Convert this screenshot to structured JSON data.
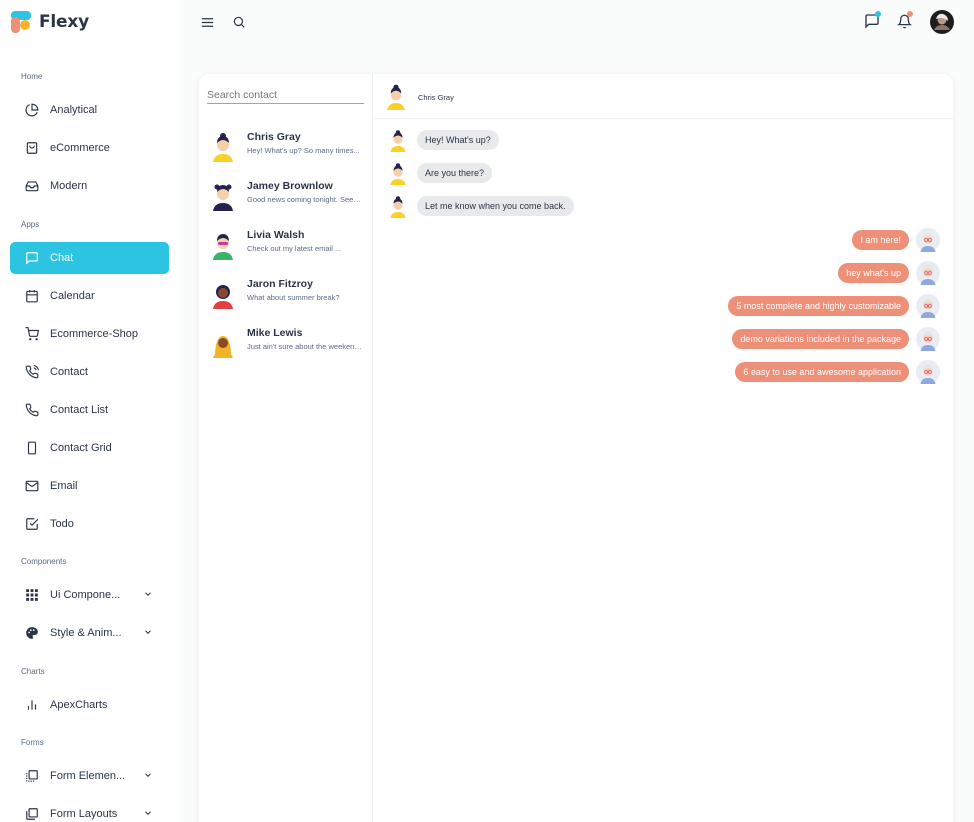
{
  "app": {
    "name": "Flexy",
    "logo_colors": [
      "#2cc4e0",
      "#ee8f78",
      "#fbb12b"
    ]
  },
  "sidebar": {
    "sections": [
      {
        "label": "Home",
        "items": [
          {
            "label": "Analytical",
            "icon": "pie-chart-icon"
          },
          {
            "label": "eCommerce",
            "icon": "shopping-bag-icon"
          },
          {
            "label": "Modern",
            "icon": "inbox-icon"
          }
        ]
      },
      {
        "label": "Apps",
        "items": [
          {
            "label": "Chat",
            "icon": "message-square-icon",
            "active": true
          },
          {
            "label": "Calendar",
            "icon": "calendar-icon"
          },
          {
            "label": "Ecommerce-Shop",
            "icon": "shopping-cart-icon"
          },
          {
            "label": "Contact",
            "icon": "phone-call-icon"
          },
          {
            "label": "Contact List",
            "icon": "phone-icon"
          },
          {
            "label": "Contact Grid",
            "icon": "smartphone-icon"
          },
          {
            "label": "Email",
            "icon": "mail-icon"
          },
          {
            "label": "Todo",
            "icon": "check-square-icon"
          }
        ]
      },
      {
        "label": "Components",
        "items": [
          {
            "label": "Ui Compone...",
            "icon": "grid-icon",
            "expandable": true
          },
          {
            "label": "Style & Anim...",
            "icon": "palette-icon",
            "expandable": true
          }
        ]
      },
      {
        "label": "Charts",
        "items": [
          {
            "label": "ApexCharts",
            "icon": "bar-chart-icon"
          }
        ]
      },
      {
        "label": "Forms",
        "items": [
          {
            "label": "Form Elemen...",
            "icon": "form-elements-icon",
            "expandable": true
          },
          {
            "label": "Form Layouts",
            "icon": "form-layouts-icon",
            "expandable": true
          }
        ]
      }
    ]
  },
  "topbar": {
    "menu_icon": "menu-icon",
    "search_icon": "search-icon",
    "chat_icon": "message-icon",
    "bell_icon": "bell-icon",
    "chat_badge_color": "#2cc4e0",
    "bell_badge_color": "#ee8f78"
  },
  "contacts": {
    "search_placeholder": "Search contact",
    "list": [
      {
        "name": "Chris Gray",
        "message": "Hey! What's up? So many times...",
        "avatar": "user-avatar-1"
      },
      {
        "name": "Jamey Brownlow",
        "message": "Good news coming tonight. Seems...",
        "avatar": "user-avatar-2"
      },
      {
        "name": "Livia Walsh",
        "message": "Check out my latest email ...",
        "avatar": "user-avatar-3"
      },
      {
        "name": "Jaron Fitzroy",
        "message": "What about summer break?",
        "avatar": "user-avatar-4"
      },
      {
        "name": "Mike Lewis",
        "message": "Just ain't sure about the weekend...",
        "avatar": "user-avatar-5"
      }
    ]
  },
  "chat": {
    "header_name": "Chris Gray",
    "incoming": [
      "Hey! What's up?",
      "Are you there?",
      "Let me know when you come back."
    ],
    "outgoing": [
      "I am here!",
      "hey what's up",
      "5 most complete and highly customizable",
      "demo variations included in the package",
      "6 easy to use and awesome application"
    ]
  },
  "colors": {
    "accent": "#2cc4e0",
    "outgoing_bubble": "#ee8f78",
    "incoming_bubble": "#e8e9ea"
  }
}
